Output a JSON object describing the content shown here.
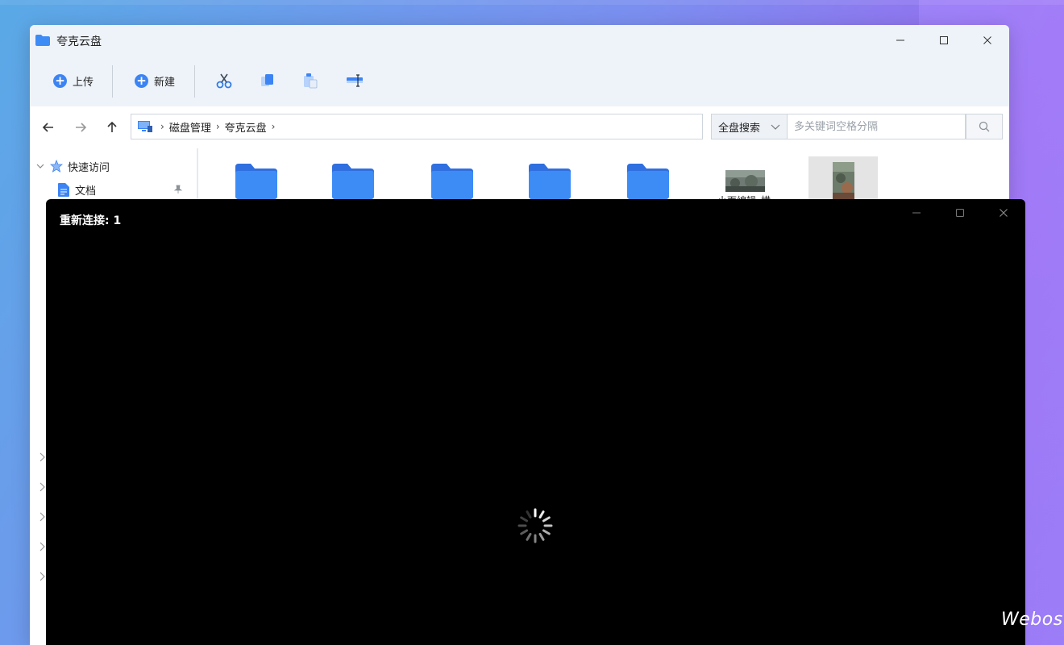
{
  "explorer": {
    "title": "夸克云盘",
    "toolbar": {
      "upload_label": "上传",
      "new_label": "新建"
    },
    "breadcrumb": [
      "磁盘管理",
      "夸克云盘"
    ],
    "search": {
      "scope": "全盘搜索",
      "placeholder": "多关键词空格分隔"
    },
    "sidebar": {
      "quick_access": "快速访问",
      "items": [
        "文档"
      ]
    },
    "files": {
      "thumb_label": "小面编辑_横"
    }
  },
  "remote": {
    "title": "重新连接: 1"
  },
  "brand": "Webos",
  "colors": {
    "accent": "#3c84f4",
    "folder": "#3d8cf6",
    "remote_bg": "#000000"
  }
}
